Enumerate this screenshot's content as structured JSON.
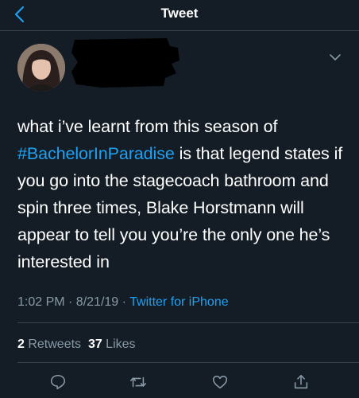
{
  "header": {
    "title": "Tweet"
  },
  "icons": {
    "back": "chevron-left-icon",
    "menu": "chevron-down-icon",
    "reply": "reply-icon",
    "retweet": "retweet-icon",
    "like": "heart-icon",
    "share": "share-icon"
  },
  "colors": {
    "background": "#141d26",
    "link": "#1da1f2",
    "muted": "#8899a6",
    "divider": "#38444d"
  },
  "tweet": {
    "text_before": "what i’ve learnt from this season of ",
    "hashtag": "#BachelorInParadise",
    "text_after": " is that legend states if you go into the stagecoach bathroom and spin three times, Blake Horstmann will appear to tell you you’re the only one he’s interested in",
    "time": "1:02 PM · 8/21/19 · ",
    "source": "Twitter for iPhone"
  },
  "stats": {
    "retweets_count": "2",
    "retweets_label": " Retweets  ",
    "likes_count": "37",
    "likes_label": " Likes"
  }
}
